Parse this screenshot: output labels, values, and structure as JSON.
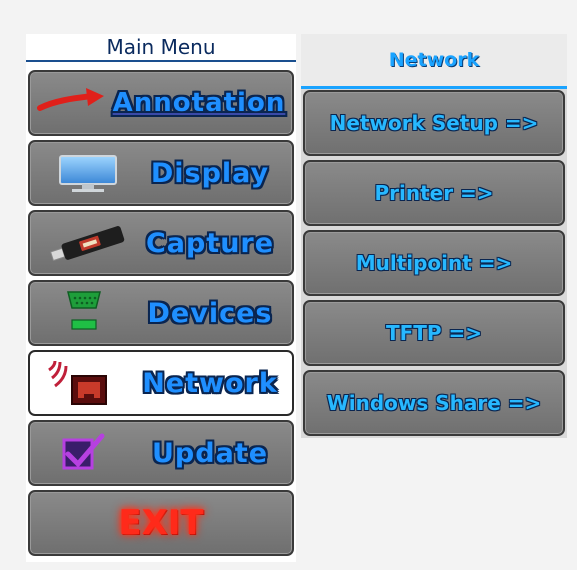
{
  "main_menu": {
    "title": "Main Menu",
    "items": [
      {
        "label": "Annotation",
        "icon": "red-arrow-icon"
      },
      {
        "label": "Display",
        "icon": "monitor-icon"
      },
      {
        "label": "Capture",
        "icon": "usb-stick-icon"
      },
      {
        "label": "Devices",
        "icon": "serial-port-icon"
      },
      {
        "label": "Network",
        "icon": "network-port-icon"
      },
      {
        "label": "Update",
        "icon": "checkbox-icon"
      },
      {
        "label": "EXIT",
        "icon": ""
      }
    ],
    "active": "Network"
  },
  "network_panel": {
    "title": "Network",
    "items": [
      {
        "label": "Network Setup =>"
      },
      {
        "label": "Printer =>"
      },
      {
        "label": "Multipoint =>"
      },
      {
        "label": "TFTP =>"
      },
      {
        "label": "Windows Share =>"
      }
    ]
  },
  "colors": {
    "accent": "#1aa3ff",
    "button_gray": "#7c7c7c",
    "exit_red": "#ff2a1a"
  }
}
